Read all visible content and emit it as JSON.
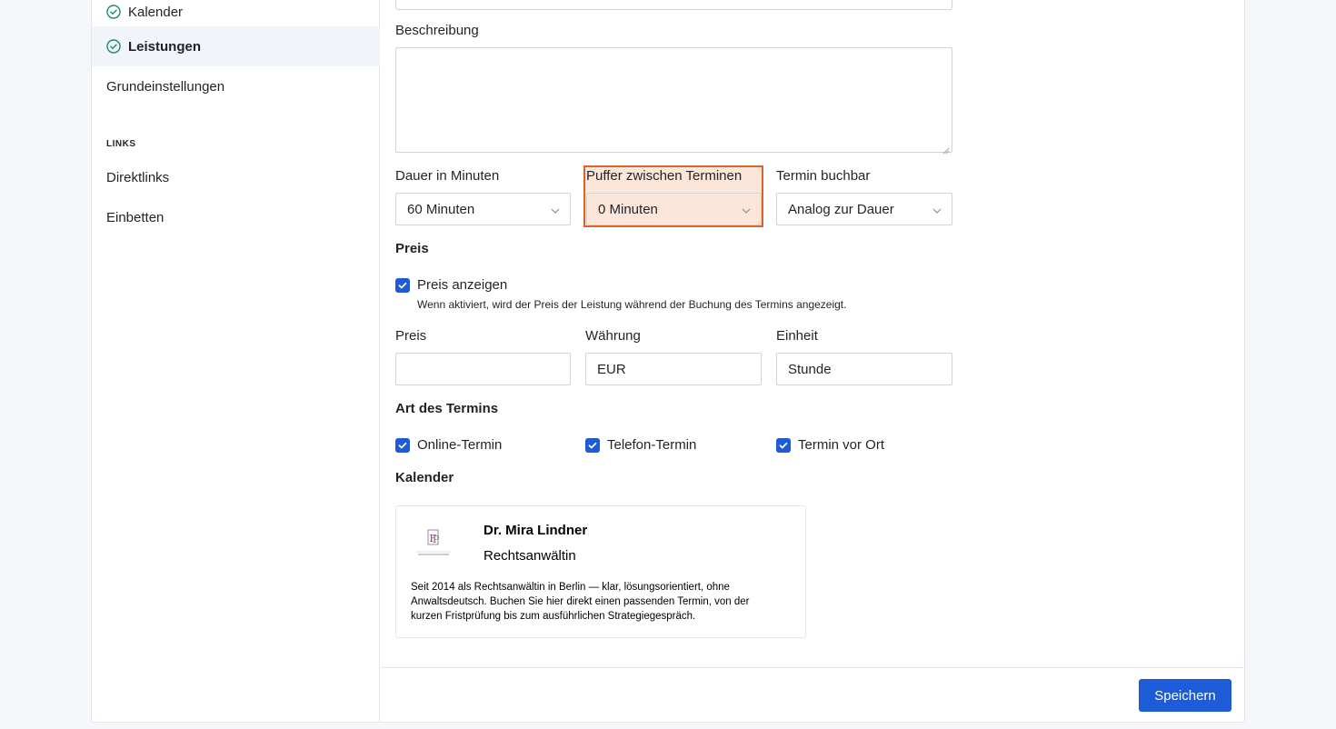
{
  "sidebar": {
    "items": [
      {
        "label": "Kalender",
        "checked": true,
        "active": false
      },
      {
        "label": "Leistungen",
        "checked": true,
        "active": true
      },
      {
        "label": "Grundeinstellungen",
        "checked": false,
        "active": false
      }
    ],
    "links_heading": "LINKS",
    "links": [
      {
        "label": "Direktlinks"
      },
      {
        "label": "Einbetten"
      }
    ]
  },
  "form": {
    "beschreibung_label": "Beschreibung",
    "beschreibung_value": "",
    "dauer_label": "Dauer in Minuten",
    "dauer_value": "60 Minuten",
    "puffer_label": "Puffer zwischen Terminen",
    "puffer_value": "0 Minuten",
    "buchbar_label": "Termin buchbar",
    "buchbar_value": "Analog zur Dauer",
    "preis_section": "Preis",
    "preis_anzeigen_label": "Preis anzeigen",
    "preis_anzeigen_checked": true,
    "preis_anzeigen_hint": "Wenn aktiviert, wird der Preis der Leistung während der Buchung des Termins angezeigt.",
    "preis_label": "Preis",
    "preis_value": "",
    "waehrung_label": "Währung",
    "waehrung_value": "EUR",
    "einheit_label": "Einheit",
    "einheit_value": "Stunde",
    "art_section": "Art des Termins",
    "art_options": [
      {
        "label": "Online-Termin",
        "checked": true
      },
      {
        "label": "Telefon-Termin",
        "checked": true
      },
      {
        "label": "Termin vor Ort",
        "checked": true
      }
    ],
    "kalender_section": "Kalender"
  },
  "calendar_card": {
    "name": "Dr. Mira Lindner",
    "role": "Rechtsanwältin",
    "description": "Seit 2014 als Rechtsanwältin in Berlin — klar, lösungsorientiert, ohne Anwaltsdeutsch. Buchen Sie hier direkt einen passenden Termin, von der kurzen Fristprüfung bis zum ausführlichen Strategiegespräch."
  },
  "footer": {
    "save_label": "Speichern"
  },
  "colors": {
    "accent": "#1d5bd8",
    "check_green": "#1a8a6a",
    "highlight_border": "#d9652b"
  }
}
